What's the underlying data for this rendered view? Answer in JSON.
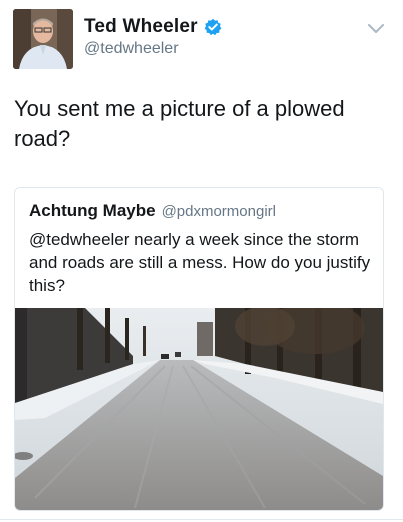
{
  "tweet": {
    "display_name": "Ted Wheeler",
    "handle": "@tedwheeler",
    "verified": true,
    "text": "You sent me a picture of a plowed road?",
    "menu_icon": "chevron-down-icon",
    "avatar": "profile-photo"
  },
  "quoted_tweet": {
    "display_name": "Achtung Maybe",
    "handle": "@pdxmormongirl",
    "text": "@tedwheeler nearly a week since the storm and roads are still a mess. How do you justify this?",
    "media": "photo-icy-road"
  },
  "colors": {
    "verified_blue": "#1da1f2",
    "secondary_text": "#657786",
    "border": "#e1e8ed"
  }
}
